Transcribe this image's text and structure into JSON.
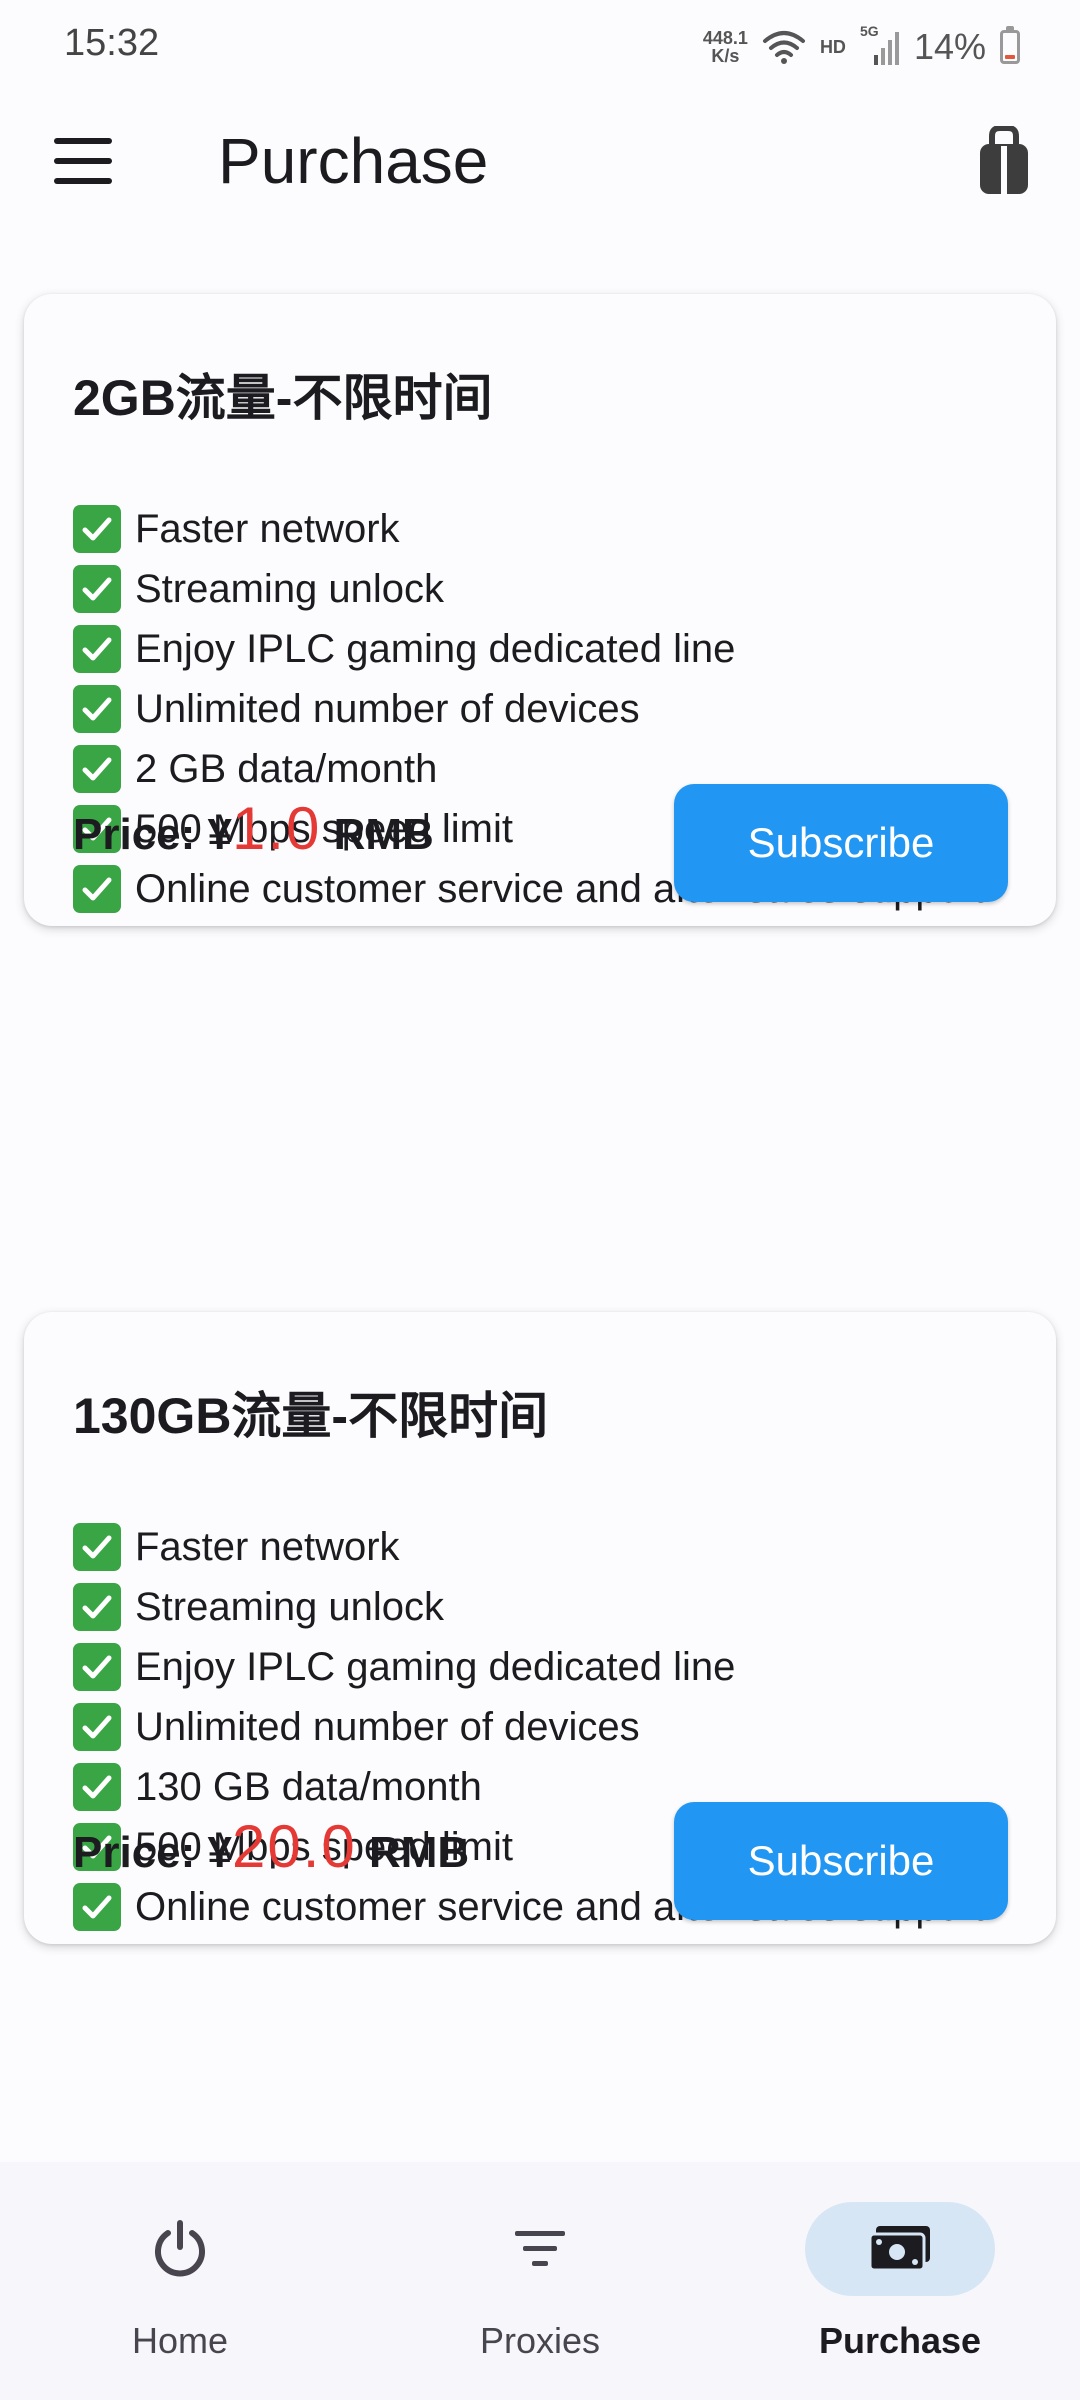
{
  "status_bar": {
    "time": "15:32",
    "net_speed_value": "448.1",
    "net_speed_unit": "K/s",
    "hd_label": "HD",
    "network_label": "5G",
    "battery_percent": "14%",
    "battery_level": 0.14,
    "icons": [
      "wifi-icon",
      "signal-icon",
      "battery-icon"
    ]
  },
  "app_bar": {
    "title": "Purchase",
    "menu_icon": "menu-icon",
    "action_icon": "shopping-bag-icon"
  },
  "plans": [
    {
      "title": "2GB流量-不限时间",
      "features": [
        "Faster network",
        "Streaming unlock",
        "Enjoy IPLC gaming dedicated line",
        "Unlimited number of devices",
        "2 GB data/month",
        "500 Mbps speed limit",
        "Online customer service and after-sales support"
      ],
      "price_label": "Price: ¥",
      "price_amount": "1.0",
      "price_unit": " RMB",
      "button_label": "Subscribe"
    },
    {
      "title": "130GB流量-不限时间",
      "features": [
        "Faster network",
        "Streaming unlock",
        "Enjoy IPLC gaming dedicated line",
        "Unlimited number of devices",
        "130 GB data/month",
        "500 Mbps speed limit",
        "Online customer service and after-sales support"
      ],
      "price_label": "Price: ¥",
      "price_amount": "20.0",
      "price_unit": " RMB",
      "button_label": "Subscribe"
    }
  ],
  "bottom_nav": {
    "items": [
      {
        "label": "Home",
        "icon": "power-icon",
        "active": false
      },
      {
        "label": "Proxies",
        "icon": "filter-icon",
        "active": false
      },
      {
        "label": "Purchase",
        "icon": "money-icon",
        "active": true
      }
    ]
  },
  "colors": {
    "accent": "#2196f3",
    "price": "#e53935",
    "check": "#3aa544",
    "nav_active_bg": "#d7e6f5"
  }
}
